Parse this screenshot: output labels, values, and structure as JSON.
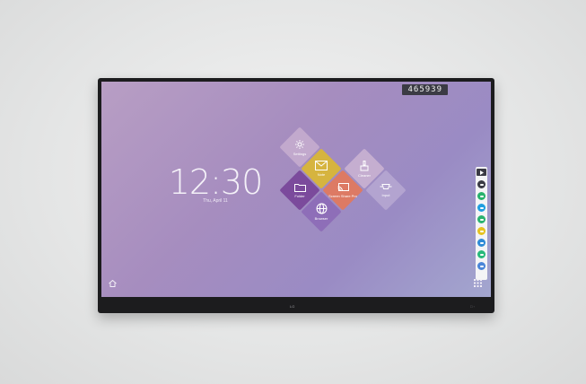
{
  "screen": {
    "code": "465939",
    "clock": {
      "time": "12:30",
      "date": "Thu, April 11"
    },
    "apps": [
      {
        "key": "settings",
        "label": "Settings",
        "color": "#c2a9cd",
        "icon": "gear-icon"
      },
      {
        "key": "note",
        "label": "Note",
        "color": "#d6b43f",
        "icon": "envelope-icon"
      },
      {
        "key": "folder",
        "label": "Folder",
        "color": "#7b4a9c",
        "icon": "folder-icon"
      },
      {
        "key": "screen-share",
        "label": "Screen Share Pro",
        "color": "#dd7a64",
        "icon": "cast-icon"
      },
      {
        "key": "cleaner",
        "label": "Cleaner",
        "color": "#c5aed0",
        "icon": "brush-icon"
      },
      {
        "key": "input",
        "label": "Input",
        "color": "#b3a4d0",
        "icon": "hdmi-icon"
      },
      {
        "key": "browser",
        "label": "Browser",
        "color": "#8e6eb8",
        "icon": "globe-icon"
      }
    ],
    "toolbar": {
      "items": [
        {
          "name": "back-tool",
          "color": "#3a3a44"
        },
        {
          "name": "pen-tool",
          "color": "#27b16c"
        },
        {
          "name": "screenshot-tool",
          "color": "#1f9ee0"
        },
        {
          "name": "whiteboard-tool",
          "color": "#2ab26f"
        },
        {
          "name": "highlight-tool",
          "color": "#e6c21f"
        },
        {
          "name": "eraser-tool",
          "color": "#2e8ad6"
        },
        {
          "name": "share-tool",
          "color": "#27b97a"
        },
        {
          "name": "settings-tool",
          "color": "#4a86d8"
        }
      ]
    }
  },
  "bezel": {
    "brand": "LG",
    "ports": "□ ◦"
  }
}
